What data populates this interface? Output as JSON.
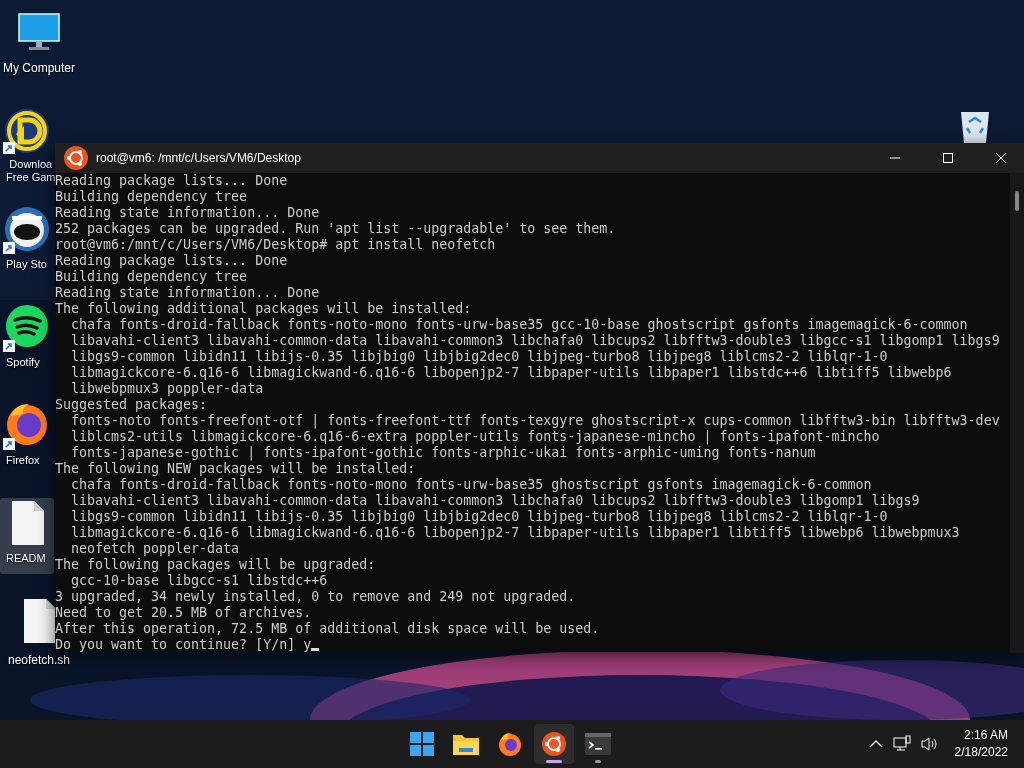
{
  "desktop_icons": [
    {
      "kind": "computer",
      "label": "My Computer",
      "shortcut": false,
      "selected": false
    },
    {
      "kind": "downloader",
      "label": "Downloa\nFree Gam",
      "shortcut": true,
      "selected": false
    },
    {
      "kind": "robot",
      "label": "Play Sto",
      "shortcut": true,
      "selected": false
    },
    {
      "kind": "spotify",
      "label": "Spotify",
      "shortcut": true,
      "selected": false
    },
    {
      "kind": "firefox",
      "label": "Firefox",
      "shortcut": true,
      "selected": false
    },
    {
      "kind": "file",
      "label": "READM",
      "shortcut": false,
      "selected": true
    },
    {
      "kind": "file",
      "label": "neofetch.sh",
      "shortcut": false,
      "selected": false
    }
  ],
  "terminal": {
    "title": "root@vm6: /mnt/c/Users/VM6/Desktop",
    "lines": [
      "Reading package lists... Done",
      "Building dependency tree",
      "Reading state information... Done",
      "252 packages can be upgraded. Run 'apt list --upgradable' to see them.",
      "root@vm6:/mnt/c/Users/VM6/Desktop# apt install neofetch",
      "Reading package lists... Done",
      "Building dependency tree",
      "Reading state information... Done",
      "The following additional packages will be installed:",
      "  chafa fonts-droid-fallback fonts-noto-mono fonts-urw-base35 gcc-10-base ghostscript gsfonts imagemagick-6-common",
      "  libavahi-client3 libavahi-common-data libavahi-common3 libchafa0 libcups2 libfftw3-double3 libgcc-s1 libgomp1 libgs9",
      "  libgs9-common libidn11 libijs-0.35 libjbig0 libjbig2dec0 libjpeg-turbo8 libjpeg8 liblcms2-2 liblqr-1-0",
      "  libmagickcore-6.q16-6 libmagickwand-6.q16-6 libopenjp2-7 libpaper-utils libpaper1 libstdc++6 libtiff5 libwebp6",
      "  libwebpmux3 poppler-data",
      "Suggested packages:",
      "  fonts-noto fonts-freefont-otf | fonts-freefont-ttf fonts-texgyre ghostscript-x cups-common libfftw3-bin libfftw3-dev",
      "  liblcms2-utils libmagickcore-6.q16-6-extra poppler-utils fonts-japanese-mincho | fonts-ipafont-mincho",
      "  fonts-japanese-gothic | fonts-ipafont-gothic fonts-arphic-ukai fonts-arphic-uming fonts-nanum",
      "The following NEW packages will be installed:",
      "  chafa fonts-droid-fallback fonts-noto-mono fonts-urw-base35 ghostscript gsfonts imagemagick-6-common",
      "  libavahi-client3 libavahi-common-data libavahi-common3 libchafa0 libcups2 libfftw3-double3 libgomp1 libgs9",
      "  libgs9-common libidn11 libijs-0.35 libjbig0 libjbig2dec0 libjpeg-turbo8 libjpeg8 liblcms2-2 liblqr-1-0",
      "  libmagickcore-6.q16-6 libmagickwand-6.q16-6 libopenjp2-7 libpaper-utils libpaper1 libtiff5 libwebp6 libwebpmux3",
      "  neofetch poppler-data",
      "The following packages will be upgraded:",
      "  gcc-10-base libgcc-s1 libstdc++6",
      "3 upgraded, 34 newly installed, 0 to remove and 249 not upgraded.",
      "Need to get 20.5 MB of archives.",
      "After this operation, 72.5 MB of additional disk space will be used.",
      "Do you want to continue? [Y/n] y"
    ]
  },
  "taskbar": {
    "apps": [
      {
        "kind": "start",
        "selected": false,
        "open": false
      },
      {
        "kind": "folder",
        "selected": false,
        "open": false
      },
      {
        "kind": "firefox",
        "selected": false,
        "open": false
      },
      {
        "kind": "ubuntu",
        "selected": true,
        "open": true
      },
      {
        "kind": "terminal",
        "selected": false,
        "open": true
      }
    ],
    "time": "2:16 AM",
    "date": "2/18/2022"
  }
}
